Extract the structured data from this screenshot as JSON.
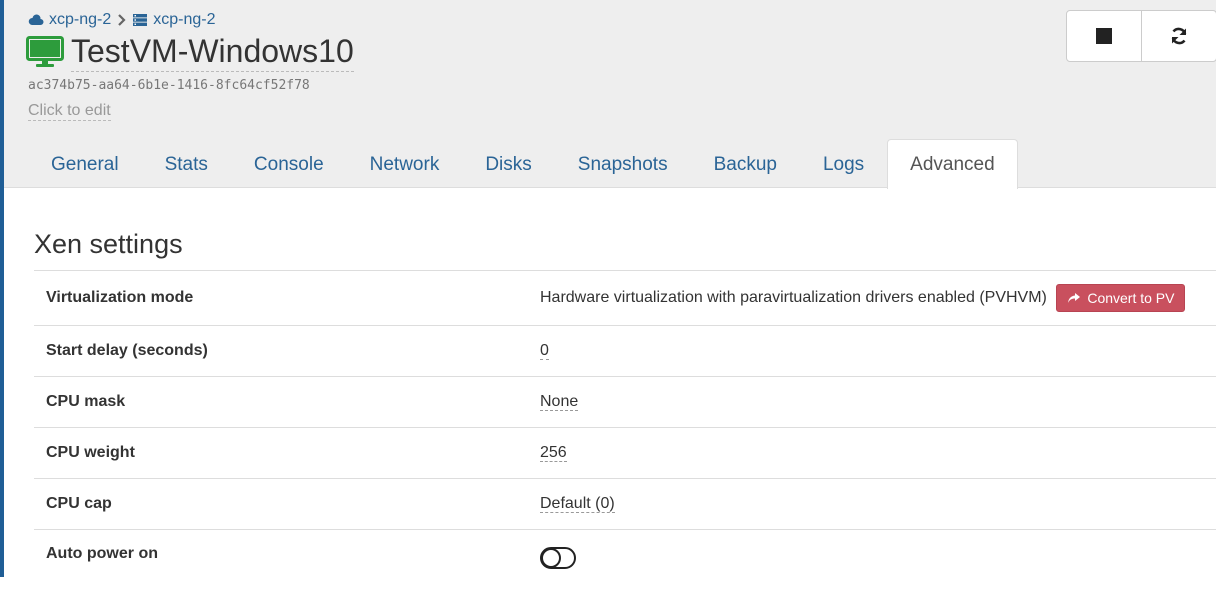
{
  "breadcrumb": {
    "pool": "xcp-ng-2",
    "host": "xcp-ng-2"
  },
  "vm": {
    "name": "TestVM-Windows10",
    "uuid": "ac374b75-aa64-6b1e-1416-8fc64cf52f78",
    "description_placeholder": "Click to edit",
    "status_color": "#2d9c3c"
  },
  "actions": [
    {
      "name": "stop",
      "icon": "stop-icon"
    },
    {
      "name": "restart",
      "icon": "refresh-icon"
    }
  ],
  "tabs": [
    "General",
    "Stats",
    "Console",
    "Network",
    "Disks",
    "Snapshots",
    "Backup",
    "Logs",
    "Advanced"
  ],
  "active_tab": "Advanced",
  "section": {
    "title": "Xen settings",
    "rows": [
      {
        "label": "Virtualization mode",
        "value": "Hardware virtualization with paravirtualization drivers enabled (PVHVM)",
        "button": "Convert to PV"
      },
      {
        "label": "Start delay (seconds)",
        "value": "0"
      },
      {
        "label": "CPU mask",
        "value": "None"
      },
      {
        "label": "CPU weight",
        "value": "256"
      },
      {
        "label": "CPU cap",
        "value": "Default (0)"
      },
      {
        "label": "Auto power on",
        "value_type": "toggle",
        "value": false
      }
    ]
  },
  "colors": {
    "link": "#2a6496",
    "danger": "#c9505e",
    "header_bg": "#eeeeee"
  }
}
